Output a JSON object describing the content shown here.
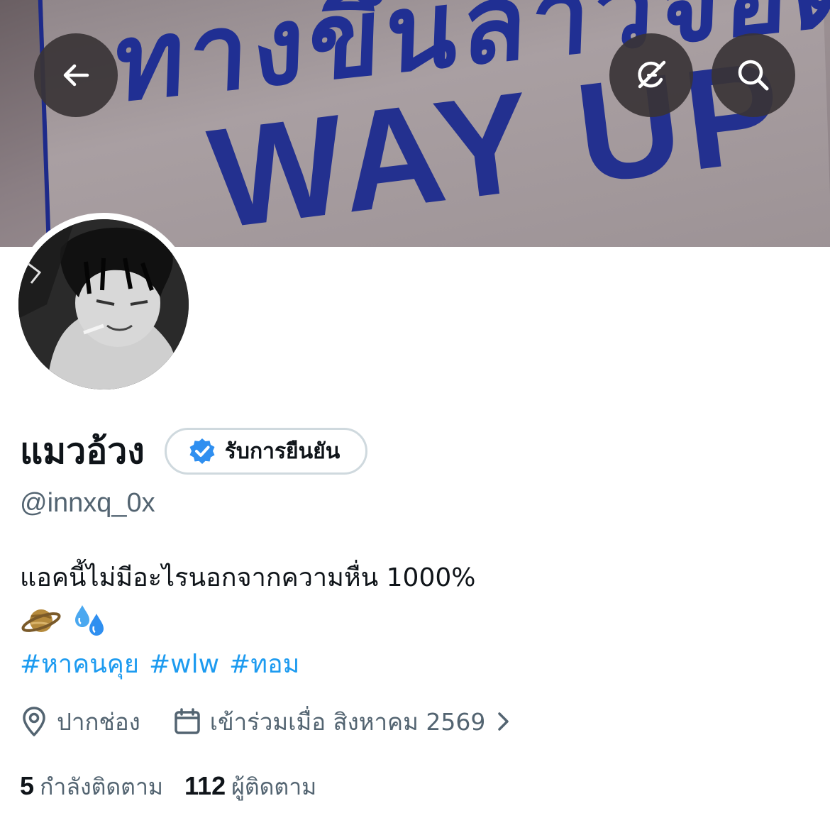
{
  "banner": {
    "sign_thai": "ทางขึ้นลาวจอด",
    "sign_english": "WAY UP",
    "back_icon": "arrow-left-icon",
    "grok_icon": "grok-icon",
    "search_icon": "search-icon"
  },
  "avatar": {
    "icon": "avatar-image"
  },
  "profile": {
    "display_name": "แมวอ้วง",
    "verify_label": "รับการยืนยัน",
    "verify_icon": "verified-badge-icon",
    "handle": "@innxq_0x",
    "bio": "แอคนี้ไม่มีอะไรนอกจากความหื่น 1000%",
    "emojis": [
      "🪐",
      "💦"
    ],
    "hashtags": [
      "#หาคนคุย",
      "#wlw",
      "#ทอม"
    ],
    "location": "ปากช่อง",
    "joined": "เข้าร่วมเมื่อ สิงหาคม 2569",
    "following_count": "5",
    "following_label": "กำลังติดตาม",
    "followers_count": "112",
    "followers_label": "ผู้ติดตาม"
  },
  "colors": {
    "accent": "#1d9bf0",
    "secondary_text": "#536471",
    "verify_badge": "#2f8ff0"
  }
}
